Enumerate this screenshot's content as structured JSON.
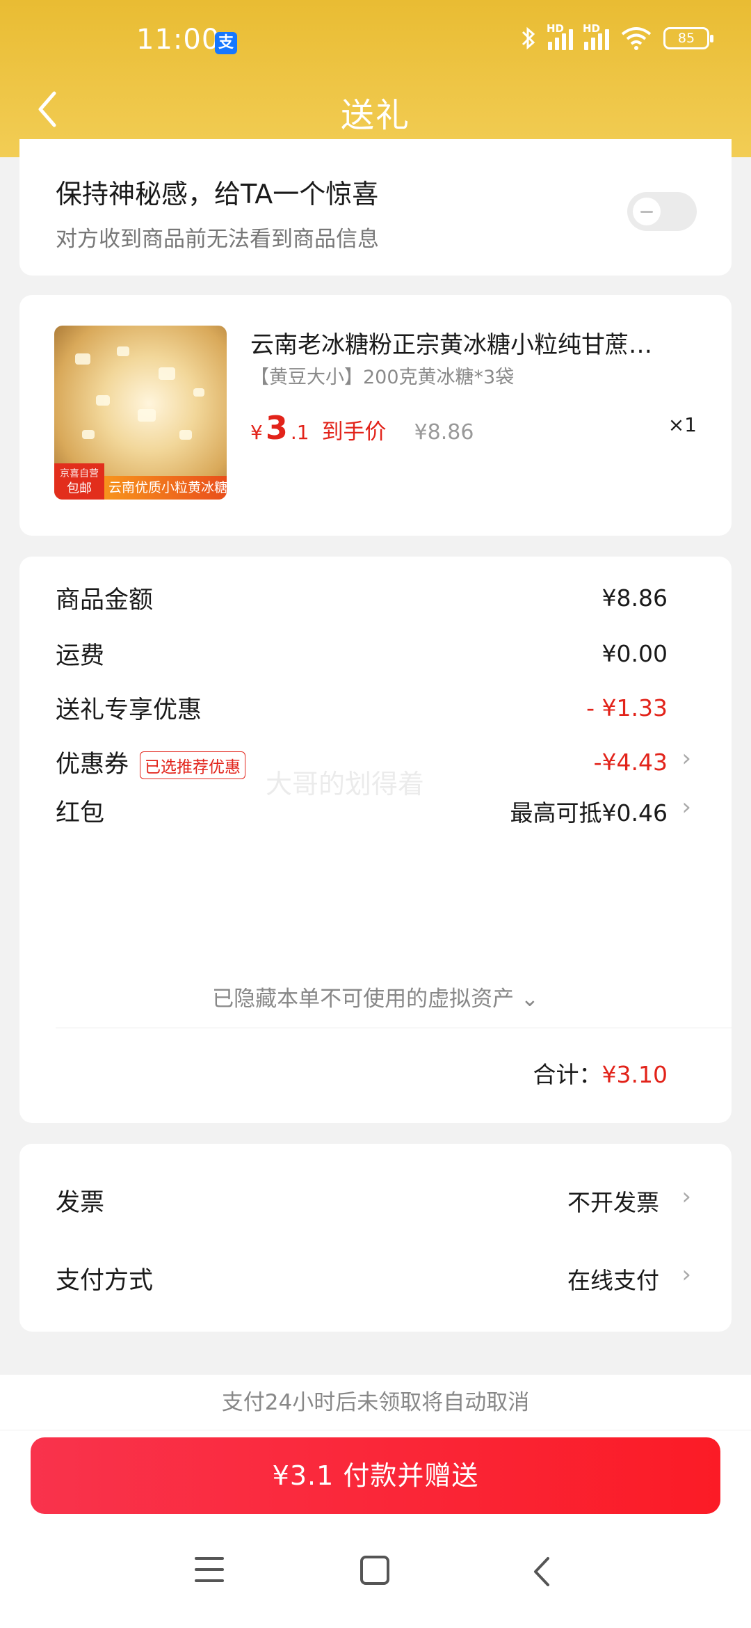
{
  "status_bar": {
    "time": "11:00",
    "battery": "85",
    "alipay_glyph": "支",
    "hd_label": "HD"
  },
  "header": {
    "title": "送礼"
  },
  "surprise": {
    "title": "保持神秘感，给TA一个惊喜",
    "subtitle": "对方收到商品前无法看到商品信息",
    "toggle_on": false
  },
  "product": {
    "name": "云南老冰糖粉正宗黄冰糖小粒纯甘蔗…",
    "spec": "【黄豆大小】200克黄冰糖*3袋",
    "price_symbol": "¥",
    "price_int": "3",
    "price_dec": ".1",
    "price_label": "到手价",
    "original_price": "¥8.86",
    "quantity": "×1",
    "image_tag_top": "京喜自营",
    "image_tag": "包邮",
    "image_caption": "云南优质小粒黄冰糖"
  },
  "summary": {
    "goods_label": "商品金额",
    "goods_value": "¥8.86",
    "shipping_label": "运费",
    "shipping_value": "¥0.00",
    "gift_discount_label": "送礼专享优惠",
    "gift_discount_value": "- ¥1.33",
    "coupon_label": "优惠券",
    "coupon_badge": "已选推荐优惠",
    "coupon_value": "-¥4.43",
    "redpacket_label": "红包",
    "redpacket_value": "最高可抵¥0.46",
    "hidden_assets": "已隐藏本单不可使用的虚拟资产 ⌄",
    "total_label": "合计：",
    "total_value": "¥3.10",
    "watermark": "大哥的划得着"
  },
  "invoice": {
    "label": "发票",
    "value": "不开发票"
  },
  "payment": {
    "label": "支付方式",
    "value": "在线支付"
  },
  "notice": "支付24小时后未领取将自动取消",
  "pay_button": "¥3.1 付款并赠送",
  "colors": {
    "header": "#f2cd55",
    "accent_red": "#e2231a",
    "pay_button": "#fb1b26"
  }
}
